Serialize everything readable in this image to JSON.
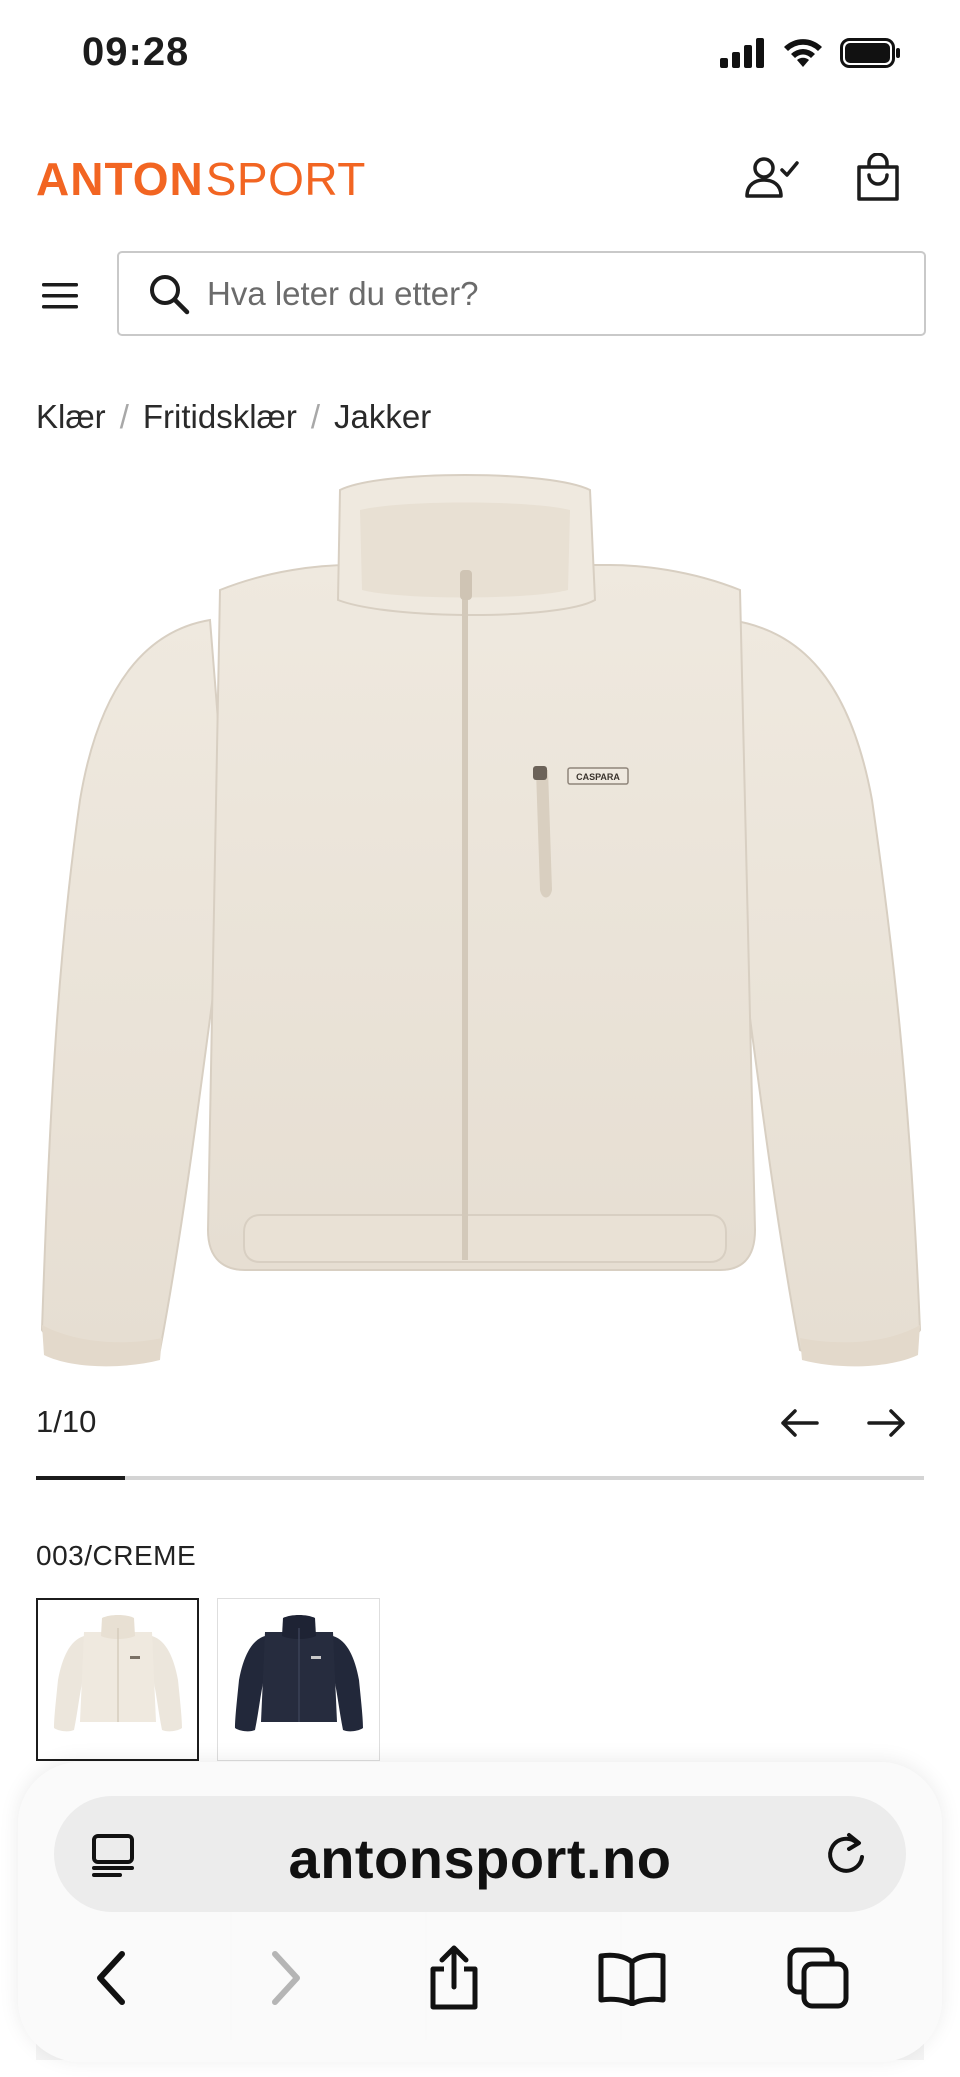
{
  "status_bar": {
    "time": "09:28"
  },
  "header": {
    "logo_primary": "ANTON",
    "logo_secondary": "SPORT",
    "brand_color": "#f26522"
  },
  "search": {
    "placeholder": "Hva leter du etter?"
  },
  "breadcrumb": [
    "Klær",
    "Fritidsklær",
    "Jakker"
  ],
  "gallery": {
    "counter": "1/10",
    "current": 1,
    "total": 10,
    "progress": 0.1,
    "main_image": "cream fleece zip jacket",
    "tag_text": "CASPARA"
  },
  "color_selection": {
    "label": "003/CREME",
    "swatches": [
      {
        "name": "cream fleece jacket",
        "color": "#ece6dc",
        "selected": true
      },
      {
        "name": "navy fleece jacket",
        "color": "#22283a",
        "selected": false
      }
    ]
  },
  "browser": {
    "url": "antonsport.no",
    "toolbar": [
      "back",
      "forward",
      "share",
      "bookmarks",
      "tabs"
    ]
  }
}
